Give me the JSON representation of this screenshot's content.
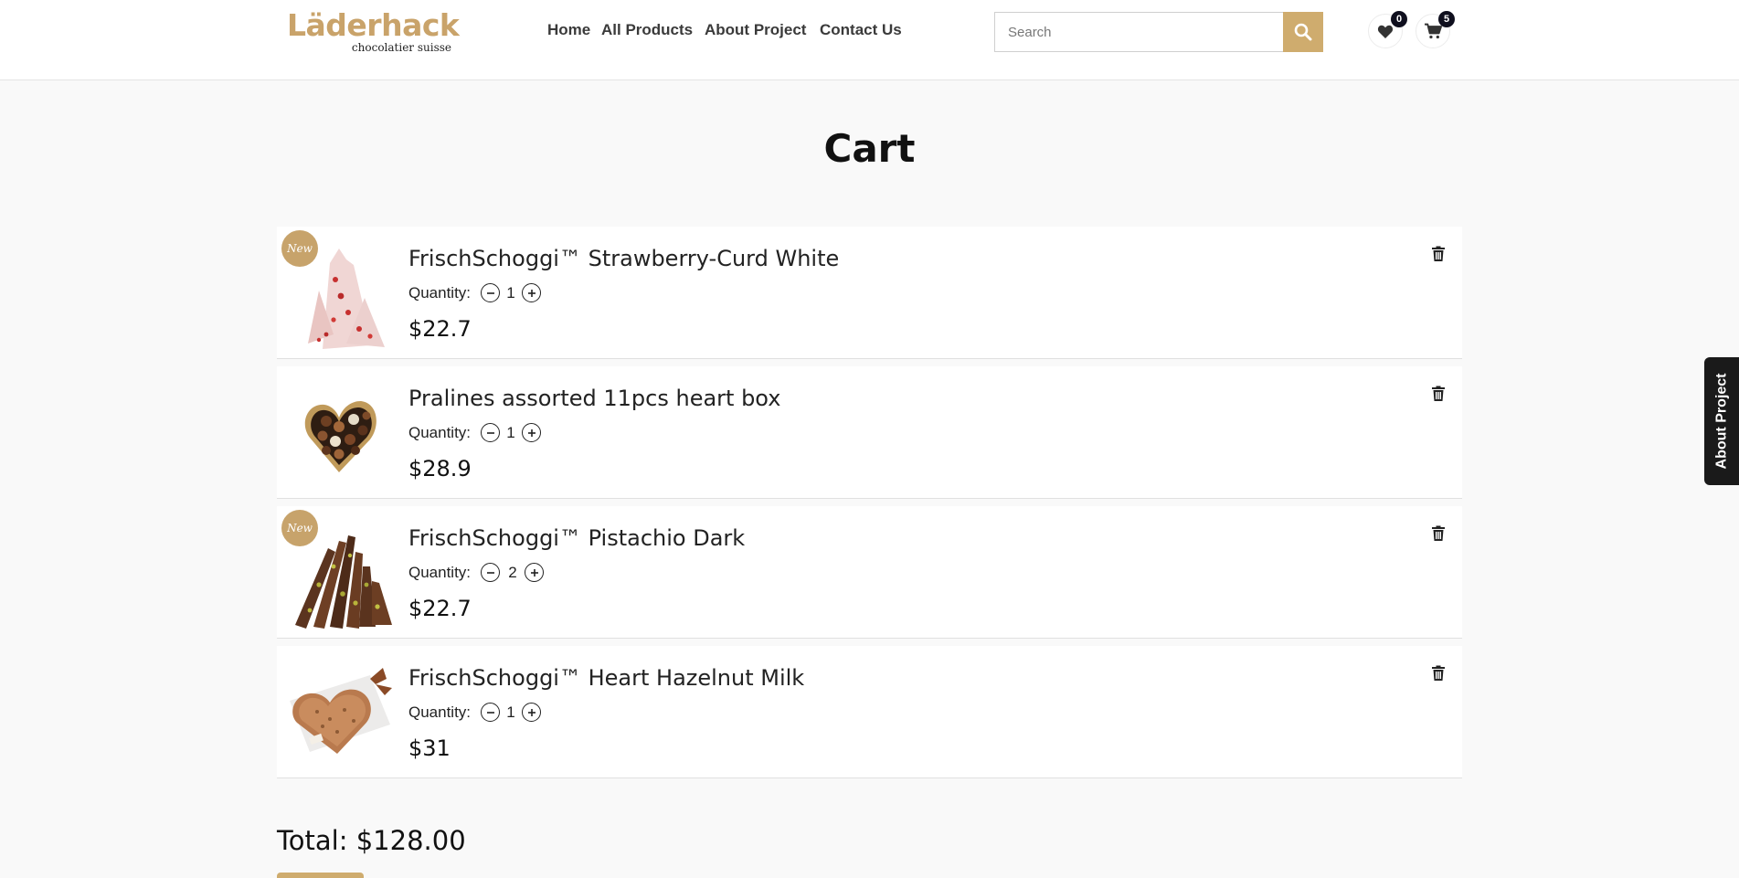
{
  "brand": {
    "name": "Läderhack",
    "tagline": "chocolatier suisse",
    "accent": "#cfac6e"
  },
  "nav": [
    "Home",
    "All Products",
    "About Project",
    "Contact Us"
  ],
  "search": {
    "placeholder": "Search",
    "icon": "search-icon"
  },
  "header_icons": {
    "wishlist_count": "0",
    "cart_count": "5"
  },
  "page": {
    "title": "Cart"
  },
  "cart": {
    "quantity_label": "Quantity:",
    "items": [
      {
        "name": "FrischSchoggi™ Strawberry-Curd White",
        "quantity": "1",
        "price": "$22.7",
        "badge": "New"
      },
      {
        "name": "Pralines assorted 11pcs heart box",
        "quantity": "1",
        "price": "$28.9",
        "badge": ""
      },
      {
        "name": "FrischSchoggi™ Pistachio Dark",
        "quantity": "2",
        "price": "$22.7",
        "badge": "New"
      },
      {
        "name": "FrischSchoggi™ Heart Hazelnut Milk",
        "quantity": "1",
        "price": "$31",
        "badge": ""
      }
    ],
    "total": "Total: $128.00"
  },
  "side_tab": {
    "label": "About Project"
  }
}
